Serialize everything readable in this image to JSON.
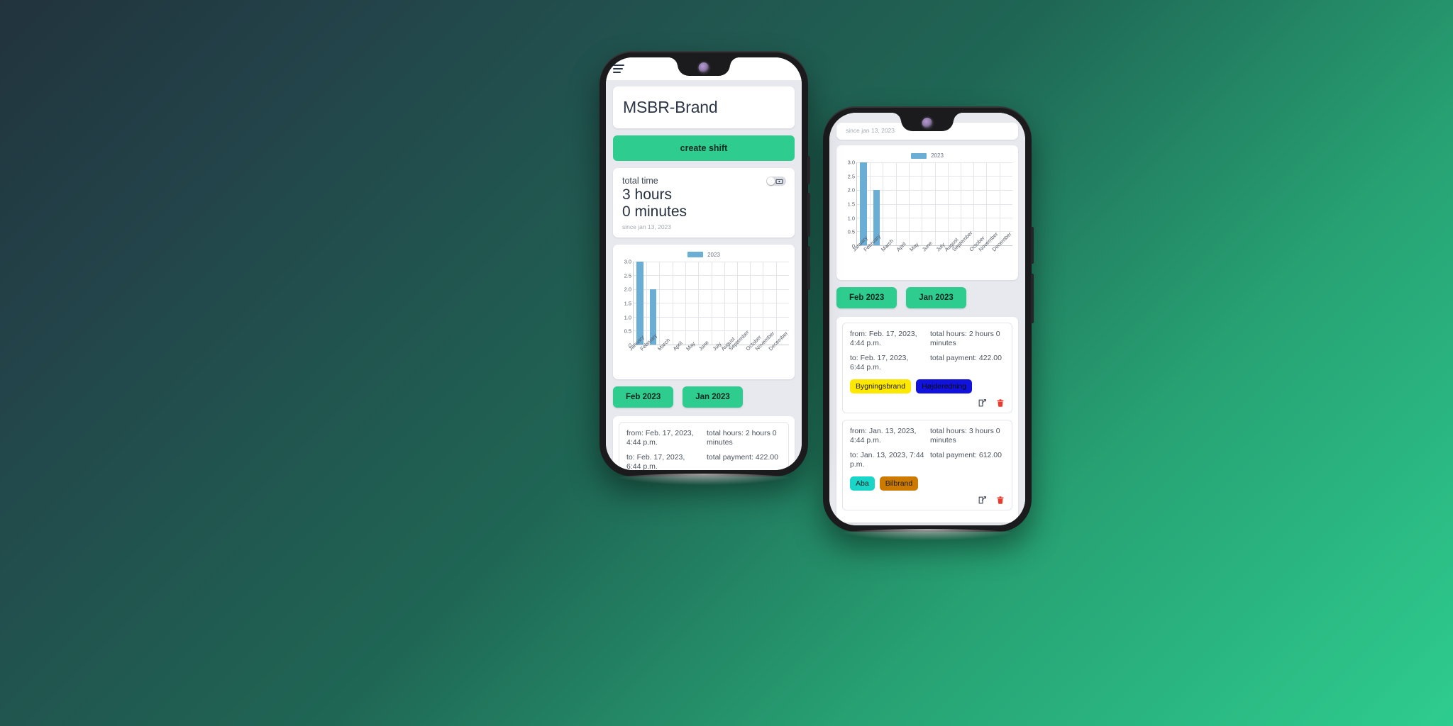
{
  "app": {
    "menu_icon": "hamburger-icon",
    "brand_title": "MSBR-Brand",
    "create_shift_label": "create shift"
  },
  "total_time_card": {
    "label": "total time",
    "hours": "3 hours",
    "minutes": "0 minutes",
    "since": "since jan 13, 2023",
    "toggle_icon": "money-icon",
    "toggle_state": "off"
  },
  "chart_data": {
    "type": "bar",
    "title": "",
    "xlabel": "",
    "ylabel": "",
    "legend": [
      "2023"
    ],
    "legend_position": "top-center",
    "grid": true,
    "ylim": [
      0,
      3.0
    ],
    "yticks": [
      "3.0",
      "2.5",
      "2.0",
      "1.5",
      "1.0",
      "0.5",
      "0"
    ],
    "categories": [
      "January",
      "February",
      "March",
      "April",
      "May",
      "June",
      "July",
      "August",
      "September",
      "October",
      "November",
      "December"
    ],
    "series": [
      {
        "name": "2023",
        "color": "#6aaed6",
        "values": [
          3.0,
          2.0,
          0,
          0,
          0,
          0,
          0,
          0,
          0,
          0,
          0,
          0
        ]
      }
    ]
  },
  "month_buttons": [
    {
      "label": "Feb 2023"
    },
    {
      "label": "Jan 2023"
    }
  ],
  "shifts": [
    {
      "from": "from: Feb. 17, 2023, 4:44 p.m.",
      "total_hours": "total hours: 2 hours 0 minutes",
      "to": "to: Feb. 17, 2023, 6:44 p.m.",
      "total_payment": "total payment: 422.00",
      "tags": [
        {
          "label": "Bygningsbrand",
          "color": "#ffe800",
          "text": "dark"
        },
        {
          "label": "Højderedning",
          "color": "#1212dd",
          "text": "dark"
        }
      ],
      "edit_icon": "edit-icon",
      "delete_icon": "trash-icon"
    },
    {
      "from": "from: Jan. 13, 2023, 4:44 p.m.",
      "total_hours": "total hours: 3 hours 0 minutes",
      "to": "to: Jan. 13, 2023, 7:44 p.m.",
      "total_payment": "total payment: 612.00",
      "tags": [
        {
          "label": "Aba",
          "color": "#1ad6c8",
          "text": "dark"
        },
        {
          "label": "Bilbrand",
          "color": "#cc7a00",
          "text": "dark"
        }
      ],
      "edit_icon": "edit-icon",
      "delete_icon": "trash-icon"
    }
  ],
  "colors": {
    "brand_green": "#2ecc8f",
    "bar_blue": "#6aaed6",
    "app_background": "#e7e9ee",
    "delete_red": "#f0372b",
    "background_gradient_start": "#22333d",
    "background_gradient_end": "#2ecc8f"
  }
}
